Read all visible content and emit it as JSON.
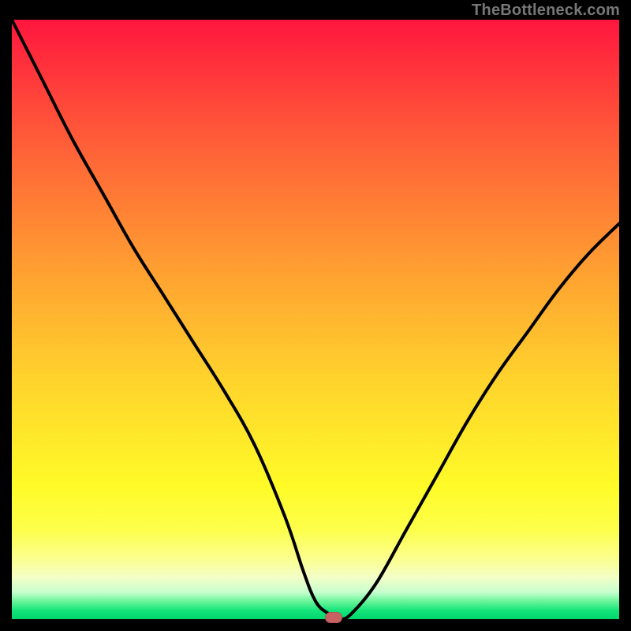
{
  "watermark": "TheBottleneck.com",
  "colors": {
    "page_bg": "#000000",
    "curve": "#000000",
    "marker": "#c86262",
    "watermark": "#777777"
  },
  "chart_data": {
    "type": "line",
    "title": "",
    "xlabel": "",
    "ylabel": "",
    "xlim": [
      0,
      100
    ],
    "ylim": [
      0,
      100
    ],
    "grid": false,
    "legend": false,
    "gradient_meaning": "background color top=red (worst/high bottleneck) → bottom=green (best/no bottleneck)",
    "series": [
      {
        "name": "bottleneck-curve",
        "x": [
          0,
          5,
          10,
          15,
          20,
          25,
          30,
          35,
          40,
          45,
          48,
          50,
          52,
          54,
          56,
          60,
          65,
          70,
          75,
          80,
          85,
          90,
          95,
          100
        ],
        "values": [
          100,
          90,
          80,
          71,
          62,
          54,
          46,
          38,
          29,
          17,
          8,
          3,
          1,
          0,
          1,
          6,
          15,
          24,
          33,
          41,
          48,
          55,
          61,
          66
        ]
      }
    ],
    "marker": {
      "x": 53,
      "y": 0
    }
  }
}
